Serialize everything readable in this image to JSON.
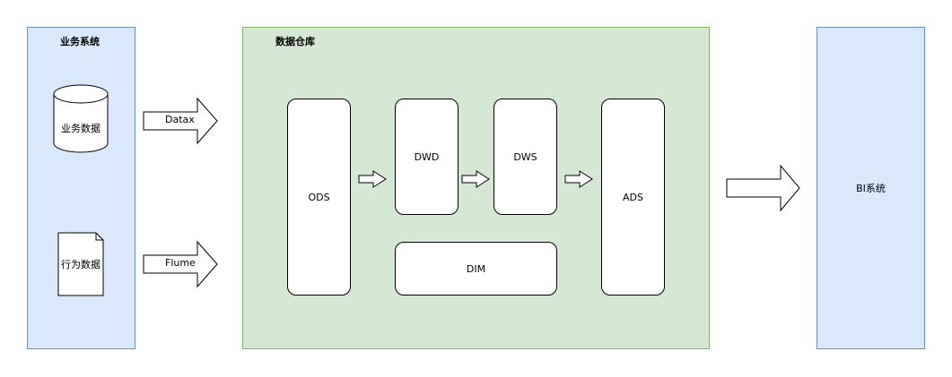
{
  "business_system": {
    "title": "业务系统",
    "database_label": "业务数据",
    "document_label": "行为数据"
  },
  "warehouse": {
    "title": "数据仓库",
    "ods": "ODS",
    "dwd": "DWD",
    "dws": "DWS",
    "ads": "ADS",
    "dim": "DIM"
  },
  "arrows": {
    "datax": "Datax",
    "flume": "Flume"
  },
  "bi_system": {
    "label": "BI系统"
  },
  "colors": {
    "blue_fill": "#dae8fc",
    "blue_border": "#6c8ebf",
    "green_fill": "#d5e8d4",
    "green_border": "#82b366"
  }
}
